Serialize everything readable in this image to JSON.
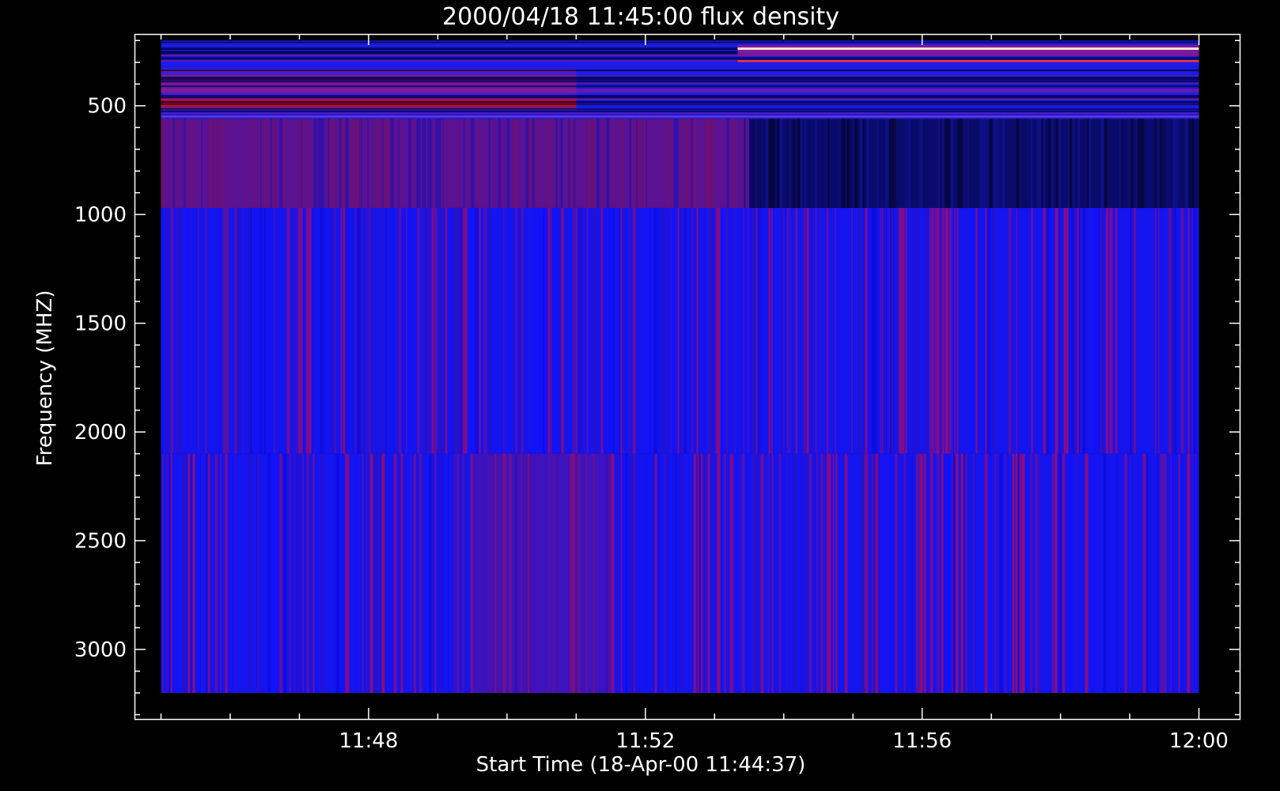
{
  "chart_data": {
    "type": "heatmap",
    "title": "2000/04/18 11:45:00 flux density",
    "xlabel": "Start Time (18-Apr-00 11:44:37)",
    "ylabel": "Frequency (MHZ)",
    "y_reversed": true,
    "xlim": [
      "11:44:37",
      "12:00:36"
    ],
    "ylim": [
      3320,
      170
    ],
    "data_extent": {
      "x": [
        "11:45:00",
        "12:00:00"
      ],
      "y": [
        200,
        3200
      ]
    },
    "xticks": [
      "11:48",
      "11:52",
      "11:56",
      "12:00"
    ],
    "yticks": [
      500,
      1000,
      1500,
      2000,
      2500,
      3000
    ],
    "colormap": [
      "#000033",
      "#0000ff",
      "#cc0000",
      "#ffffff"
    ],
    "bands": [
      {
        "name": "200-560 MHz",
        "y": [
          200,
          560
        ],
        "description": "red emission near 500 MHz before 11:50, bright narrow lines near 230 and 290 MHz after 11:53"
      },
      {
        "name": "560-970 MHz",
        "y": [
          560,
          970
        ],
        "description": "reddish before ~11:53, dark blue after"
      },
      {
        "name": "970-2100 MHz",
        "y": [
          970,
          2100
        ],
        "description": "blue with faint red striations"
      },
      {
        "name": "2100-3200 MHz",
        "y": [
          2100,
          3200
        ],
        "description": "blue with faint red striations, reddish near 11:50"
      }
    ]
  }
}
